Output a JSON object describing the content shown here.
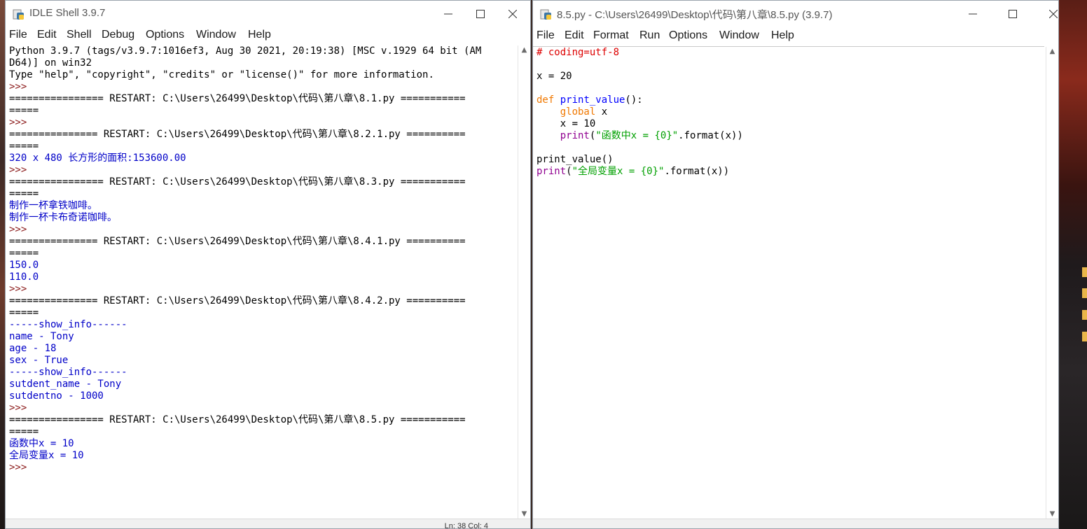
{
  "shell": {
    "title": "IDLE Shell 3.9.7",
    "menu": [
      "File",
      "Edit",
      "Shell",
      "Debug",
      "Options",
      "Window",
      "Help"
    ],
    "lines": [
      {
        "text": "Python 3.9.7 (tags/v3.9.7:1016ef3, Aug 30 2021, 20:19:38) [MSC v.1929 64 bit (AM",
        "style": "plain"
      },
      {
        "text": "D64)] on win32",
        "style": "plain"
      },
      {
        "text": "Type \"help\", \"copyright\", \"credits\" or \"license()\" for more information.",
        "style": "plain"
      },
      {
        "text": ">>> ",
        "style": "prompt"
      },
      {
        "text": "================ RESTART: C:\\Users\\26499\\Desktop\\代码\\第八章\\8.1.py ===========",
        "style": "plain"
      },
      {
        "text": "=====",
        "style": "plain"
      },
      {
        "text": ">>> ",
        "style": "prompt"
      },
      {
        "text": "=============== RESTART: C:\\Users\\26499\\Desktop\\代码\\第八章\\8.2.1.py ==========",
        "style": "plain"
      },
      {
        "text": "=====",
        "style": "plain"
      },
      {
        "text": "320 x 480 长方形的面积:153600.00",
        "style": "stdout"
      },
      {
        "text": ">>> ",
        "style": "prompt"
      },
      {
        "text": "================ RESTART: C:\\Users\\26499\\Desktop\\代码\\第八章\\8.3.py ===========",
        "style": "plain"
      },
      {
        "text": "=====",
        "style": "plain"
      },
      {
        "text": "制作一杯拿铁咖啡。",
        "style": "stdout"
      },
      {
        "text": "制作一杯卡布奇诺咖啡。",
        "style": "stdout"
      },
      {
        "text": ">>> ",
        "style": "prompt"
      },
      {
        "text": "=============== RESTART: C:\\Users\\26499\\Desktop\\代码\\第八章\\8.4.1.py ==========",
        "style": "plain"
      },
      {
        "text": "=====",
        "style": "plain"
      },
      {
        "text": "150.0",
        "style": "stdout"
      },
      {
        "text": "110.0",
        "style": "stdout"
      },
      {
        "text": ">>> ",
        "style": "prompt"
      },
      {
        "text": "=============== RESTART: C:\\Users\\26499\\Desktop\\代码\\第八章\\8.4.2.py ==========",
        "style": "plain"
      },
      {
        "text": "=====",
        "style": "plain"
      },
      {
        "text": "-----show_info------",
        "style": "stdout"
      },
      {
        "text": "name - Tony",
        "style": "stdout"
      },
      {
        "text": "age - 18",
        "style": "stdout"
      },
      {
        "text": "sex - True",
        "style": "stdout"
      },
      {
        "text": "-----show_info------",
        "style": "stdout"
      },
      {
        "text": "sutdent_name - Tony",
        "style": "stdout"
      },
      {
        "text": "sutdentno - 1000",
        "style": "stdout"
      },
      {
        "text": ">>> ",
        "style": "prompt"
      },
      {
        "text": "================ RESTART: C:\\Users\\26499\\Desktop\\代码\\第八章\\8.5.py ===========",
        "style": "plain"
      },
      {
        "text": "=====",
        "style": "plain"
      },
      {
        "text": "函数中x = 10",
        "style": "stdout"
      },
      {
        "text": "全局变量x = 10",
        "style": "stdout"
      },
      {
        "text": ">>> ",
        "style": "prompt"
      }
    ]
  },
  "editor": {
    "title": "8.5.py - C:\\Users\\26499\\Desktop\\代码\\第八章\\8.5.py (3.9.7)",
    "menu": [
      "File",
      "Edit",
      "Format",
      "Run",
      "Options",
      "Window",
      "Help"
    ],
    "lines": [
      [
        {
          "t": "# coding=utf-8",
          "c": "com"
        }
      ],
      [],
      [
        {
          "t": "x = 20",
          "c": "plain"
        }
      ],
      [],
      [
        {
          "t": "def",
          "c": "kw"
        },
        {
          "t": " ",
          "c": "plain"
        },
        {
          "t": "print_value",
          "c": "def"
        },
        {
          "t": "():",
          "c": "plain"
        }
      ],
      [
        {
          "t": "    ",
          "c": "plain"
        },
        {
          "t": "global",
          "c": "kw"
        },
        {
          "t": " x",
          "c": "plain"
        }
      ],
      [
        {
          "t": "    x = 10",
          "c": "plain"
        }
      ],
      [
        {
          "t": "    ",
          "c": "plain"
        },
        {
          "t": "print",
          "c": "bi"
        },
        {
          "t": "(",
          "c": "plain"
        },
        {
          "t": "\"函数中x = {0}\"",
          "c": "str"
        },
        {
          "t": ".format(x))",
          "c": "plain"
        }
      ],
      [],
      [
        {
          "t": "print_value()",
          "c": "plain"
        }
      ],
      [
        {
          "t": "print",
          "c": "bi"
        },
        {
          "t": "(",
          "c": "plain"
        },
        {
          "t": "\"全局变量x = {0}\"",
          "c": "str"
        },
        {
          "t": ".format(x))",
          "c": "plain"
        }
      ]
    ]
  },
  "status": {
    "shell_position": "Ln: 38  Col: 4"
  },
  "icons": {
    "app": "python-idle-icon",
    "minimize": "minimize-icon",
    "maximize": "maximize-icon",
    "close": "close-icon"
  },
  "colors": {
    "stdout": "#0000c8",
    "keyword": "#f07800",
    "string": "#00a000",
    "comment": "#dd0000",
    "builtin": "#900090",
    "def": "#0000ff"
  }
}
